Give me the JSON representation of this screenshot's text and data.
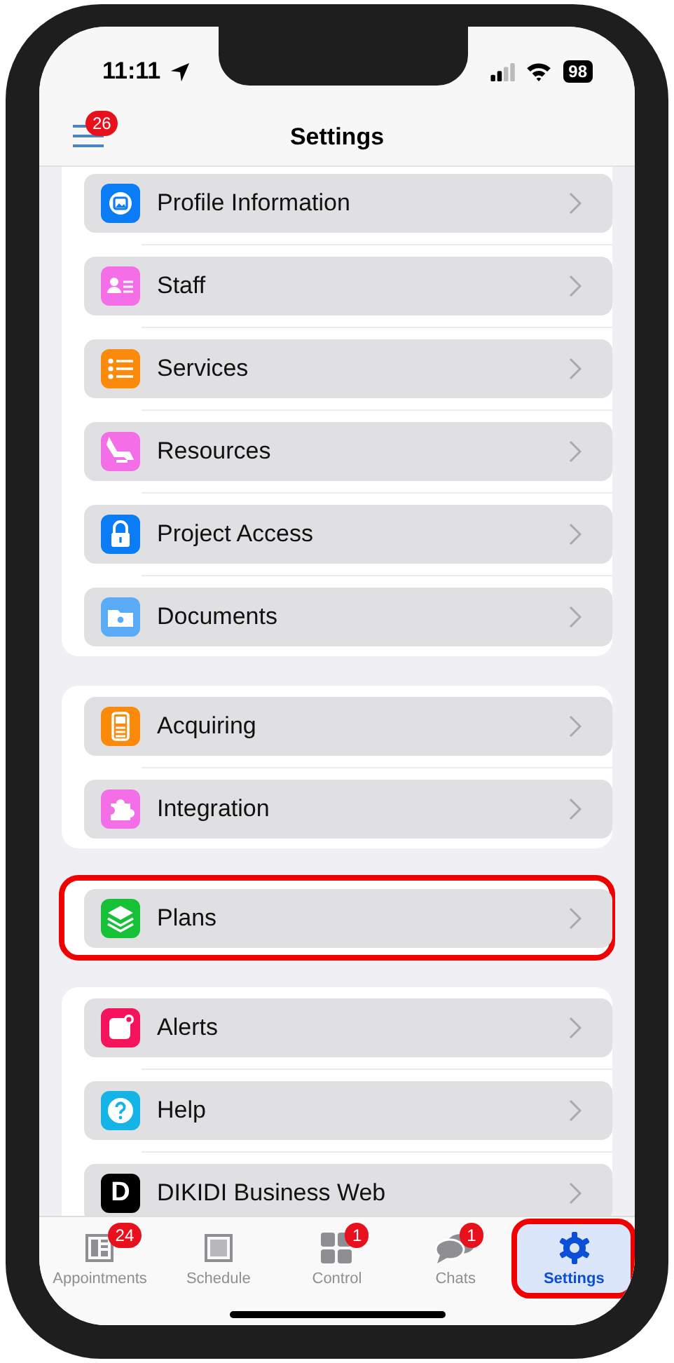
{
  "status_bar": {
    "time": "11:11",
    "battery": "98"
  },
  "header": {
    "title": "Settings",
    "menu_badge": "26"
  },
  "groups": [
    {
      "highlighted": false,
      "rows": [
        {
          "label": "Profile Information",
          "kind": "profile",
          "color": "#0a7cf5"
        },
        {
          "label": "Staff",
          "kind": "staff",
          "color": "#f46ee8"
        },
        {
          "label": "Services",
          "kind": "list",
          "color": "#fb8a0a"
        },
        {
          "label": "Resources",
          "kind": "chair",
          "color": "#f46ee8"
        },
        {
          "label": "Project Access",
          "kind": "lock",
          "color": "#0a7cf5"
        },
        {
          "label": "Documents",
          "kind": "folder",
          "color": "#5aabf6"
        }
      ]
    },
    {
      "highlighted": false,
      "rows": [
        {
          "label": "Acquiring",
          "kind": "terminal",
          "color": "#fb8a0a"
        },
        {
          "label": "Integration",
          "kind": "puzzle",
          "color": "#f46ee8"
        }
      ]
    },
    {
      "highlighted": true,
      "rows": [
        {
          "label": "Plans",
          "kind": "layers",
          "color": "#16c138"
        }
      ]
    },
    {
      "highlighted": false,
      "rows": [
        {
          "label": "Alerts",
          "kind": "alert",
          "color": "#f5135c"
        },
        {
          "label": "Help",
          "kind": "help",
          "color": "#14b4e6"
        },
        {
          "label": "DIKIDI Business Web",
          "kind": "letter",
          "letter": "D",
          "color": "#000000"
        }
      ]
    }
  ],
  "tabs": [
    {
      "label": "Appointments",
      "kind": "appointments",
      "badge": "24",
      "selected": false,
      "highlighted": false
    },
    {
      "label": "Schedule",
      "kind": "schedule",
      "selected": false,
      "highlighted": false
    },
    {
      "label": "Control",
      "kind": "grid",
      "badge": "1",
      "selected": false,
      "highlighted": false
    },
    {
      "label": "Chats",
      "kind": "chats",
      "badge": "1",
      "selected": false,
      "highlighted": false
    },
    {
      "label": "Settings",
      "kind": "gear",
      "selected": true,
      "highlighted": true
    }
  ]
}
